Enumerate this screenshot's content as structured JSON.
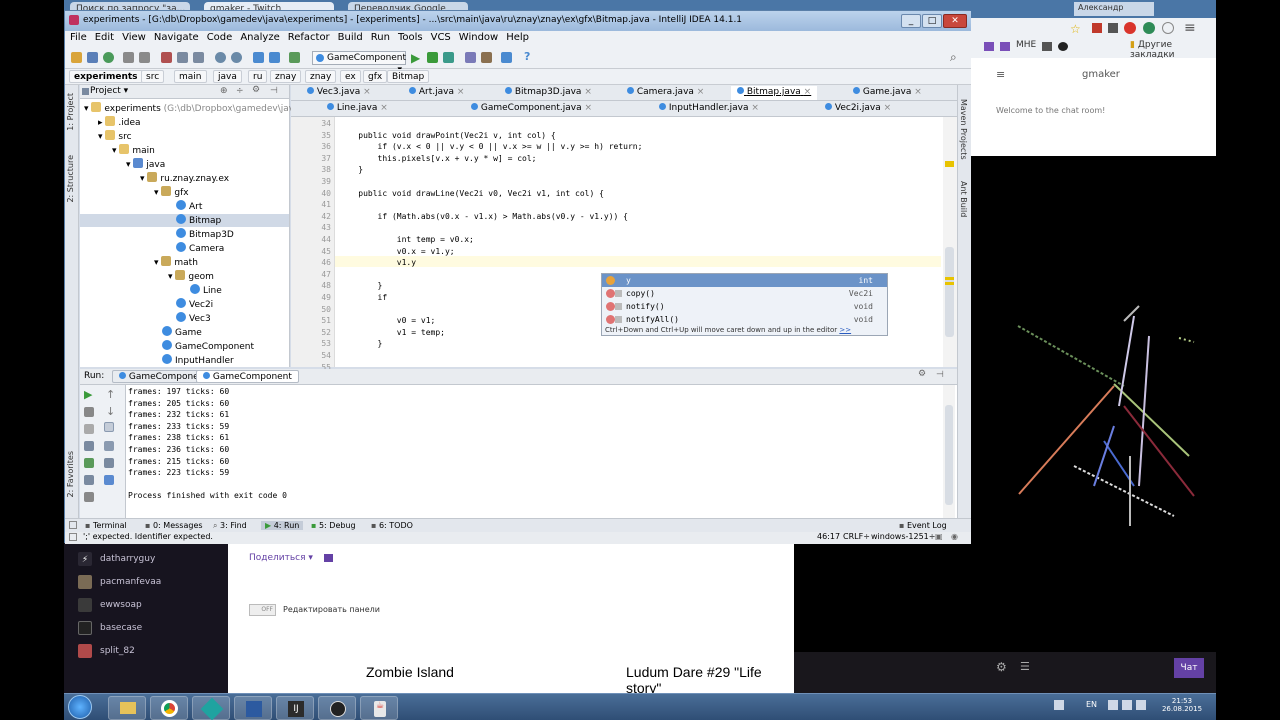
{
  "browser": {
    "tabs": [
      "Поиск по запросу \"за...",
      "gmaker - Twitch",
      "Переводчик Google"
    ],
    "user": "Александр",
    "bookmarks_other": "Другие закладки",
    "bookmark_mne": "МНЕ"
  },
  "twitch": {
    "chat_title": "gmaker",
    "chat_welcome": "Welcome to the chat room!",
    "share_label": "Поделиться",
    "edit_panels_label": "Редактировать панели",
    "toggle_label": "OFF",
    "games": [
      "Zombie Island",
      "Ludum Dare #29 \"Life story\""
    ],
    "chat_button": "Чат",
    "followers": [
      "datharryguy",
      "pacmanfevaa",
      "ewwsoap",
      "basecase",
      "split_82"
    ]
  },
  "ide": {
    "title": "experiments - [G:\\db\\Dropbox\\gamedev\\java\\experiments] - [experiments] - ...\\src\\main\\java\\ru\\znay\\znay\\ex\\gfx\\Bitmap.java - IntelliJ IDEA 14.1.1",
    "menu": [
      "File",
      "Edit",
      "View",
      "Navigate",
      "Code",
      "Analyze",
      "Refactor",
      "Build",
      "Run",
      "Tools",
      "VCS",
      "Window",
      "Help"
    ],
    "run_config": "GameComponent",
    "breadcrumbs": [
      "experiments",
      "src",
      "main",
      "java",
      "ru",
      "znay",
      "znay",
      "ex",
      "gfx",
      "Bitmap"
    ],
    "side_left": [
      "1: Project",
      "2: Structure",
      "2: Favorites"
    ],
    "side_right": [
      "Maven Projects",
      "Ant Build"
    ],
    "project_header": "Project",
    "tree": [
      {
        "label": "experiments",
        "extra": " (G:\\db\\Dropbox\\gamedev\\java\\expe"
      },
      {
        "label": ".idea"
      },
      {
        "label": "src"
      },
      {
        "label": "main"
      },
      {
        "label": "java"
      },
      {
        "label": "ru.znay.znay.ex"
      },
      {
        "label": "gfx"
      },
      {
        "label": "Art"
      },
      {
        "label": "Bitmap"
      },
      {
        "label": "Bitmap3D"
      },
      {
        "label": "Camera"
      },
      {
        "label": "math"
      },
      {
        "label": "geom"
      },
      {
        "label": "Line"
      },
      {
        "label": "Vec2i"
      },
      {
        "label": "Vec3"
      },
      {
        "label": "Game"
      },
      {
        "label": "GameComponent"
      },
      {
        "label": "InputHandler"
      }
    ],
    "tabs_row1": [
      "Vec3.java",
      "Art.java",
      "Bitmap3D.java",
      "Camera.java",
      "Bitmap.java",
      "Game.java"
    ],
    "tabs_row2": [
      "Line.java",
      "GameComponent.java",
      "InputHandler.java",
      "Vec2i.java"
    ],
    "code_lines": [
      {
        "n": "34",
        "t": ""
      },
      {
        "n": "35",
        "t": "    public void drawPoint(Vec2i v, int col) {"
      },
      {
        "n": "36",
        "t": "        if (v.x < 0 || v.y < 0 || v.x >= w || v.y >= h) return;"
      },
      {
        "n": "37",
        "t": "        this.pixels[v.x + v.y * w] = col;"
      },
      {
        "n": "38",
        "t": "    }"
      },
      {
        "n": "39",
        "t": ""
      },
      {
        "n": "40",
        "t": "    public void drawLine(Vec2i v0, Vec2i v1, int col) {"
      },
      {
        "n": "41",
        "t": ""
      },
      {
        "n": "42",
        "t": "        if (Math.abs(v0.x - v1.x) > Math.abs(v0.y - v1.y)) {"
      },
      {
        "n": "43",
        "t": ""
      },
      {
        "n": "44",
        "t": "            int temp = v0.x;"
      },
      {
        "n": "45",
        "t": "            v0.x = v1.y;"
      },
      {
        "n": "46",
        "t": "            v1.y"
      },
      {
        "n": "47",
        "t": ""
      },
      {
        "n": "48",
        "t": "        }"
      },
      {
        "n": "49",
        "t": "        if"
      },
      {
        "n": "50",
        "t": ""
      },
      {
        "n": "51",
        "t": "            v0 = v1;"
      },
      {
        "n": "52",
        "t": "            v1 = temp;"
      },
      {
        "n": "53",
        "t": "        }"
      },
      {
        "n": "54",
        "t": ""
      },
      {
        "n": "55",
        "t": ""
      }
    ],
    "completion": [
      {
        "name": "y",
        "type": "int"
      },
      {
        "name": "copy()",
        "type": "Vec2i"
      },
      {
        "name": "notify()",
        "type": "void"
      },
      {
        "name": "notifyAll()",
        "type": "void"
      }
    ],
    "completion_hint": "Ctrl+Down and Ctrl+Up will move caret down and up in the editor",
    "completion_hint_link": ">>",
    "run_label": "Run:",
    "run_tabs": [
      "GameComponent",
      "GameComponent"
    ],
    "output": [
      "frames: 197 ticks: 60",
      "frames: 205 ticks: 60",
      "frames: 232 ticks: 61",
      "frames: 233 ticks: 59",
      "frames: 238 ticks: 61",
      "frames: 236 ticks: 60",
      "frames: 215 ticks: 60",
      "frames: 223 ticks: 59",
      "",
      "Process finished with exit code 0"
    ],
    "bottom_tabs": [
      "Terminal",
      "0: Messages",
      "3: Find",
      "4: Run",
      "5: Debug",
      "6: TODO"
    ],
    "event_log": "Event Log",
    "status_msg": "';' expected. Identifier expected.",
    "status_pos": "46:17",
    "status_crlf": "CRLF÷",
    "status_enc": "windows-1251÷"
  },
  "taskbar": {
    "lang": "EN",
    "time": "21:53",
    "date": "26.08.2015"
  },
  "colors": {
    "ide_bg": "#d6dde8",
    "keyword": "#000080",
    "twitch_purple": "#6441a5"
  }
}
